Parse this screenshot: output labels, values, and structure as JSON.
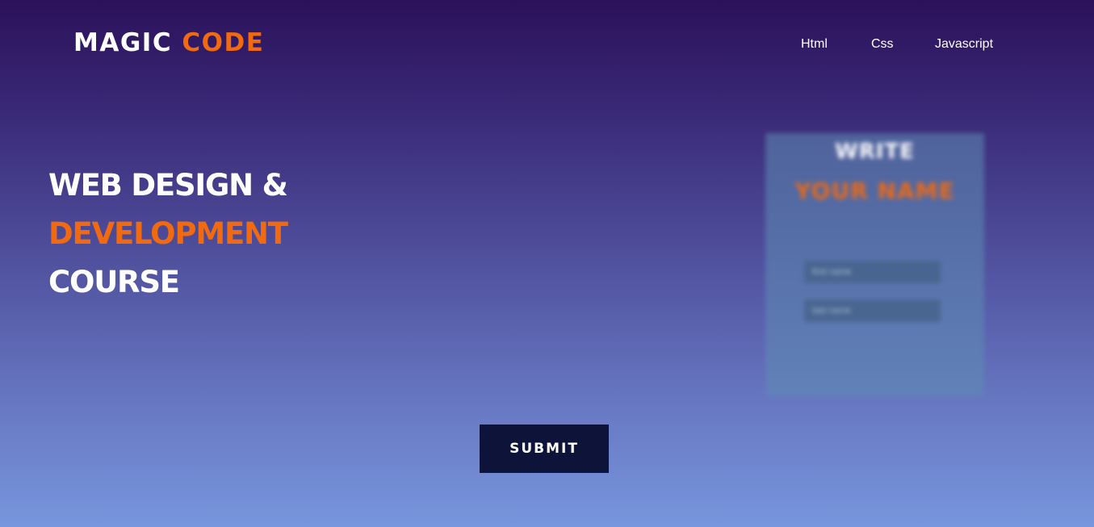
{
  "brand": {
    "first": "MAGIC",
    "second": "CODE"
  },
  "nav": {
    "items": [
      {
        "label": "Html"
      },
      {
        "label": "Css"
      },
      {
        "label": "Javascript"
      }
    ]
  },
  "hero": {
    "line1": "WEB DESIGN &",
    "line2": "DEVELOPMENT",
    "line3": "COURSE"
  },
  "card": {
    "title_line1": "WRITE",
    "title_line2": "YOUR NAME",
    "first_name_placeholder": "first name",
    "last_name_placeholder": "last name"
  },
  "submit": {
    "label": "SUBMIT"
  },
  "colors": {
    "accent": "#f26a0f",
    "text": "#ffffff",
    "button_bg": "#0e1439",
    "bg_top": "#2c115a",
    "bg_bottom": "#7796dd"
  }
}
